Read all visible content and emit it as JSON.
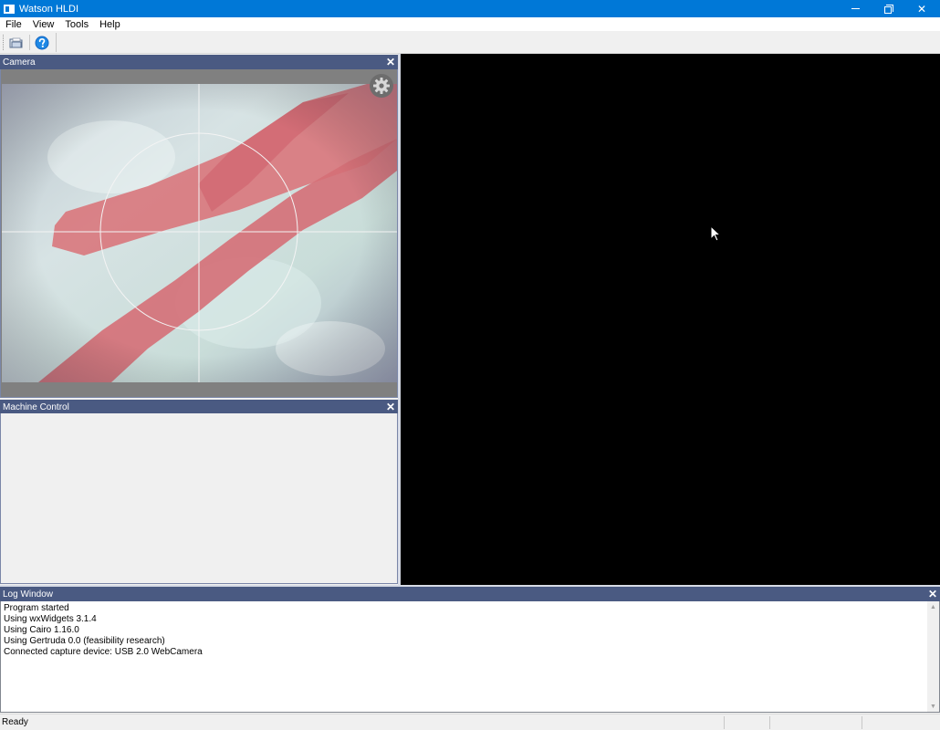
{
  "window": {
    "title": "Watson HLDI",
    "minimize_glyph": "minimize-icon",
    "restore_glyph": "restore-icon",
    "close_glyph": "✕"
  },
  "menu": {
    "items": [
      "File",
      "View",
      "Tools",
      "Help"
    ]
  },
  "toolbar": {
    "buttons": [
      {
        "icon": "open-folder-icon"
      },
      {
        "icon": "help-icon"
      }
    ]
  },
  "panes": {
    "camera": {
      "title": "Camera",
      "close": "✕",
      "settings_icon": "gear-icon"
    },
    "machine_control": {
      "title": "Machine Control",
      "close": "✕"
    },
    "log": {
      "title": "Log Window",
      "close": "✕"
    }
  },
  "log": {
    "lines": [
      "Program started",
      "Using wxWidgets 3.1.4",
      "Using Cairo 1.16.0",
      "Using Gertruda 0.0 (feasibility research)",
      "Connected capture device: USB 2.0 WebCamera"
    ]
  },
  "status": {
    "text": "Ready"
  },
  "colors": {
    "titlebar": "#0078d7",
    "caption": "#4a5a82",
    "camera_bg": "#808080",
    "view_bg": "#000000"
  }
}
